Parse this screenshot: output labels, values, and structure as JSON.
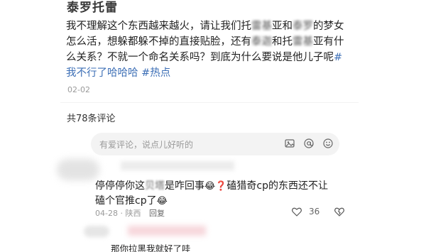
{
  "post": {
    "title": "泰罗托雷",
    "body_part1": "我不理解这个东西越来越火，请让我们托",
    "body_blur1": "雷基",
    "body_part2": "亚和",
    "body_blur2": "泰罗",
    "body_part3": "的梦女怎么活，想躲都躲不掉的直接贴脸，还有",
    "body_blur3": "泰迦",
    "body_part4": "和托",
    "body_blur4": "雷基",
    "body_part5": "亚有什么关系？不就一个命名关系吗？到底为什么要说是他儿子呢",
    "tag1": "#我不行了哈哈哈",
    "tag2": "#热点",
    "date": "02-02"
  },
  "comments_section": {
    "count_label": "共78条评论",
    "input_placeholder": "有爱评论，说点儿好听的",
    "icons": [
      "image-icon",
      "at-icon",
      "emoji-icon",
      "add-icon"
    ]
  },
  "comment": {
    "text_part1": "停停停你这",
    "text_blur": "贝塔",
    "text_part2": "是咋回事",
    "emoji1": "😂❓",
    "text_part3": "磕猎奇cp的东西还不让磕个官推cp了",
    "emoji2": "😂",
    "date": "04-28",
    "location": "陕西",
    "reply_label": "回复",
    "like_count": "36"
  },
  "reply": {
    "text": "那你拉黑我就好了哇"
  },
  "colors": {
    "hashtag": "#3d6fb6",
    "meta": "#9a9a9a"
  }
}
